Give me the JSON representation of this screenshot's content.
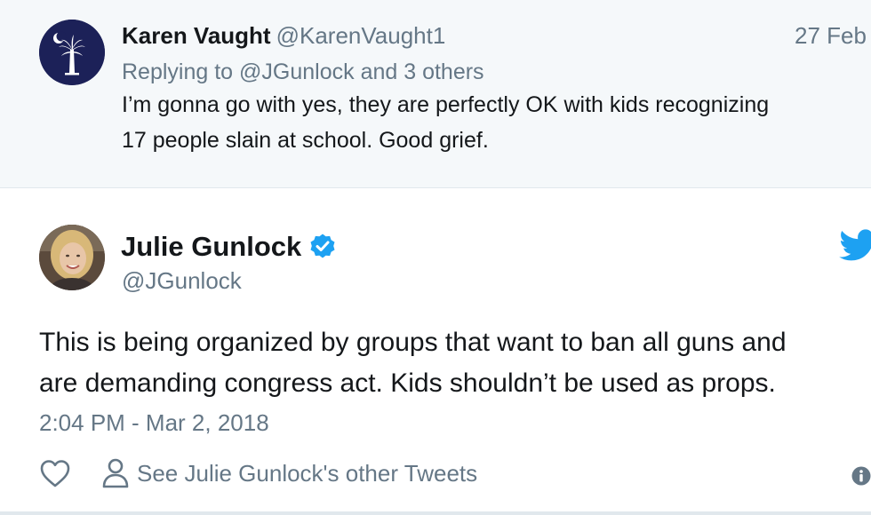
{
  "parent_tweet": {
    "author_name": "Karen Vaught",
    "author_handle": "@KarenVaught1",
    "date": "27 Feb",
    "replying_prefix": "Replying to",
    "replying_mentions": "@JGunlock and 3 others",
    "text_lines": [
      "I’m gonna go with yes, they are perfectly OK with kids recognizing",
      "17 people slain at school. Good grief."
    ],
    "avatar_icon": "palmetto-moon-flag-icon"
  },
  "main_tweet": {
    "author_name": "Julie Gunlock",
    "author_handle": "@JGunlock",
    "verified_icon": "verified-badge-icon",
    "platform_icon": "twitter-bird-icon",
    "text_lines": [
      "This is being organized by groups that want to ban all guns and",
      "are demanding congress act. Kids shouldn’t be used as props."
    ],
    "timestamp": "2:04 PM - Mar 2, 2018",
    "actions": {
      "like_icon": "heart-icon",
      "other_tweets_icon": "person-icon",
      "other_tweets_label": "See Julie Gunlock's other Tweets",
      "info_icon": "info-icon"
    }
  },
  "colors": {
    "parent_background": "#f5f8fa",
    "primary_text": "#14171a",
    "secondary_text": "#657786",
    "twitter_blue": "#1da1f2",
    "border": "#e1e8ed"
  }
}
